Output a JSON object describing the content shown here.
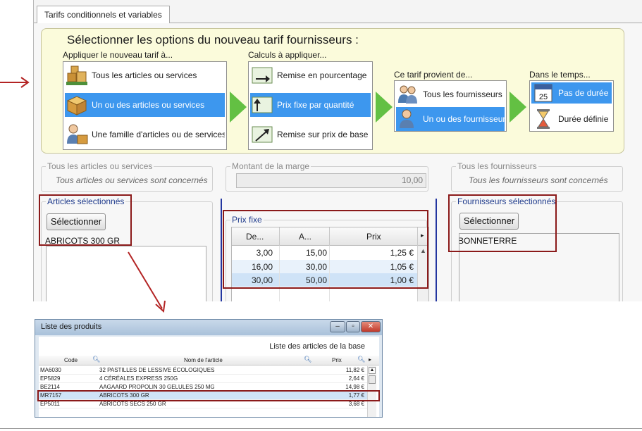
{
  "tab": {
    "label": "Tarifs conditionnels et variables"
  },
  "options": {
    "title": "Sélectionner les options du nouveau tarif fournisseurs :",
    "apply_group": {
      "label": "Appliquer le nouveau tarif à...",
      "items": [
        {
          "label": "Tous les articles ou services",
          "selected": false,
          "icon": "boxes-icon"
        },
        {
          "label": "Un ou des articles ou services",
          "selected": true,
          "icon": "box-icon"
        },
        {
          "label": "Une famille d'articles ou de services",
          "selected": false,
          "icon": "person-box-icon"
        }
      ]
    },
    "calc_group": {
      "label": "Calculs à appliquer...",
      "items": [
        {
          "label": "Remise en pourcentage",
          "selected": false,
          "icon": "arrow-right-icon"
        },
        {
          "label": "Prix fixe par quantité",
          "selected": true,
          "icon": "arrow-up-icon"
        },
        {
          "label": "Remise sur prix de base",
          "selected": false,
          "icon": "arrow-diagonal-icon"
        }
      ]
    },
    "supplier_group": {
      "label": "Ce tarif provient de...",
      "items": [
        {
          "label": "Tous les fournisseurs",
          "selected": false,
          "icon": "people-icon"
        },
        {
          "label": "Un ou des fournisseurs",
          "selected": true,
          "icon": "person-icon"
        }
      ]
    },
    "time_group": {
      "label": "Dans le temps...",
      "items": [
        {
          "label": "Pas de durée",
          "selected": true,
          "icon": "calendar-icon",
          "calendar_day": "25"
        },
        {
          "label": "Durée définie",
          "selected": false,
          "icon": "hourglass-icon"
        }
      ]
    },
    "colors": {
      "panel": "#fbfbdb",
      "selection": "#3d97ee",
      "arrow": "#63c043",
      "highlight": "#8b1a1a"
    }
  },
  "articles_all": {
    "legend": "Tous les articles ou services",
    "note": "Tous articles ou services sont concernés"
  },
  "margin": {
    "legend": "Montant de la marge",
    "value": "10,00"
  },
  "suppliers_all": {
    "legend": "Tous les fournisseurs",
    "note": "Tous les fournisseurs sont concernés"
  },
  "articles_selected": {
    "legend": "Articles sélectionnés",
    "button": "Sélectionner",
    "items": [
      "ABRICOTS 300 GR"
    ]
  },
  "prix_fixe": {
    "legend": "Prix fixe",
    "headers": [
      "De...",
      "A...",
      "Prix"
    ],
    "rows": [
      {
        "de": "3,00",
        "a": "15,00",
        "prix": "1,25 €"
      },
      {
        "de": "16,00",
        "a": "30,00",
        "prix": "1,05 €"
      },
      {
        "de": "30,00",
        "a": "50,00",
        "prix": "1,00 €"
      }
    ]
  },
  "suppliers_selected": {
    "legend": "Fournisseurs sélectionnés",
    "button": "Sélectionner",
    "items": [
      "BONNETERRE"
    ]
  },
  "popup": {
    "title": "Liste des produits",
    "subtitle": "Liste des articles de la base",
    "headers": {
      "code": "Code",
      "name": "Nom de l'article",
      "price": "Prix"
    },
    "rows": [
      {
        "code": "MA6030",
        "name": "32 PASTILLES DE LESSIVE ÉCOLOGIQUES",
        "price": "11,82 €"
      },
      {
        "code": "EP5829",
        "name": "4 CÉRÉALES EXPRESS 250G",
        "price": "2,64 €"
      },
      {
        "code": "BE2114",
        "name": "AAGAARD PROPOLIN 30 GELULES 250 MG",
        "price": "14,98 €"
      },
      {
        "code": "MR7157",
        "name": "ABRICOTS 300 GR",
        "price": "1,77 €",
        "selected": true
      },
      {
        "code": "EP5011",
        "name": "ABRICOTS SECS 250 GR",
        "price": "3,68 €"
      }
    ]
  }
}
